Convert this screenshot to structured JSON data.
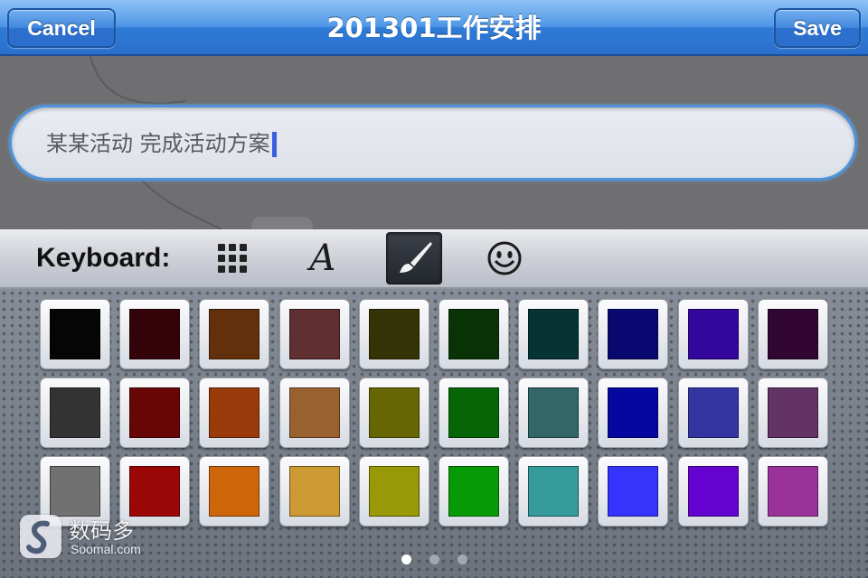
{
  "navbar": {
    "cancel_label": "Cancel",
    "title": "201301工作安排",
    "save_label": "Save"
  },
  "editor": {
    "text_value": "某某活动 完成活动方案"
  },
  "toolbar": {
    "label": "Keyboard:",
    "buttons": [
      {
        "icon": "grid-icon",
        "selected": false
      },
      {
        "icon": "font-icon",
        "selected": false,
        "glyph": "A"
      },
      {
        "icon": "paintbrush-icon",
        "selected": true
      },
      {
        "icon": "smiley-icon",
        "selected": false
      }
    ]
  },
  "palette": {
    "colors": [
      [
        "#050505",
        "#340309",
        "#62300a",
        "#5f2f32",
        "#333306",
        "#093306",
        "#063333",
        "#090870",
        "#33079c",
        "#310633"
      ],
      [
        "#333333",
        "#680506",
        "#983a0a",
        "#98612f",
        "#666604",
        "#066607",
        "#336666",
        "#0606a0",
        "#3434a2",
        "#633366"
      ],
      [
        "#717171",
        "#9b0707",
        "#cf650b",
        "#cc9a32",
        "#999806",
        "#069a06",
        "#359b9b",
        "#3533fc",
        "#6504d0",
        "#993399"
      ]
    ],
    "page_count": 3,
    "active_page": 1
  },
  "watermark": {
    "name": "数码多",
    "domain": "Soomal.com"
  }
}
